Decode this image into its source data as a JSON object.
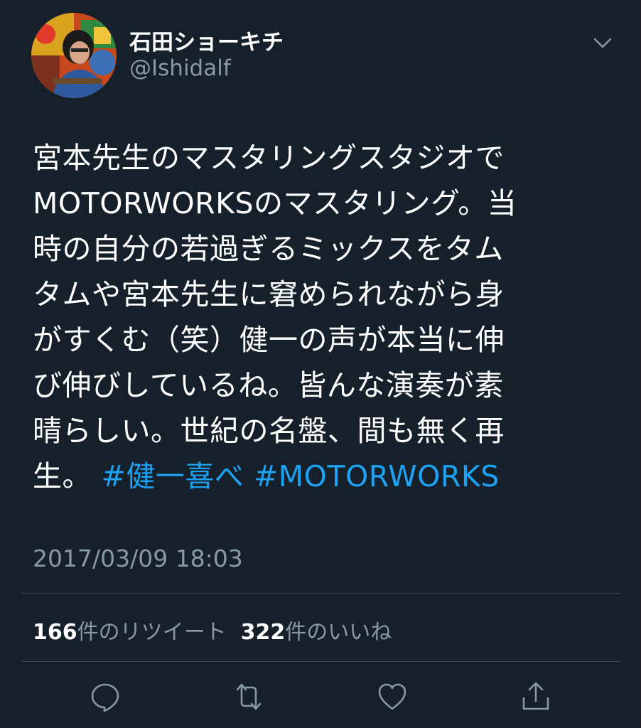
{
  "user": {
    "display_name": "石田ショーキチ",
    "handle": "@Ishidalf"
  },
  "tweet": {
    "lines": [
      "宮本先生のマスタリングスタジオで",
      "MOTORWORKSのマスタリング。当",
      "時の自分の若過ぎるミックスをタム",
      "タムや宮本先生に窘められながら身",
      "がすくむ（笑）健一の声が本当に伸",
      "び伸びしているね。皆んな演奏が素",
      "晴らしい。世紀の名盤、間も無く再"
    ],
    "last_line_prefix": "生。",
    "hashtags": [
      "#健一喜べ",
      "#MOTORWORKS"
    ],
    "timestamp": "2017/03/09 18:03"
  },
  "stats": {
    "retweet_count": "166",
    "retweet_label": "件のリツイート",
    "like_count": "322",
    "like_label": "件のいいね"
  },
  "icons": {
    "reply": "reply-icon",
    "retweet": "retweet-icon",
    "like": "heart-icon",
    "share": "share-icon",
    "menu": "chevron-down-icon"
  },
  "colors": {
    "background": "#15202b",
    "text": "#ffffff",
    "secondary": "#8899a6",
    "link": "#1da1f2",
    "divider": "#38444d"
  }
}
